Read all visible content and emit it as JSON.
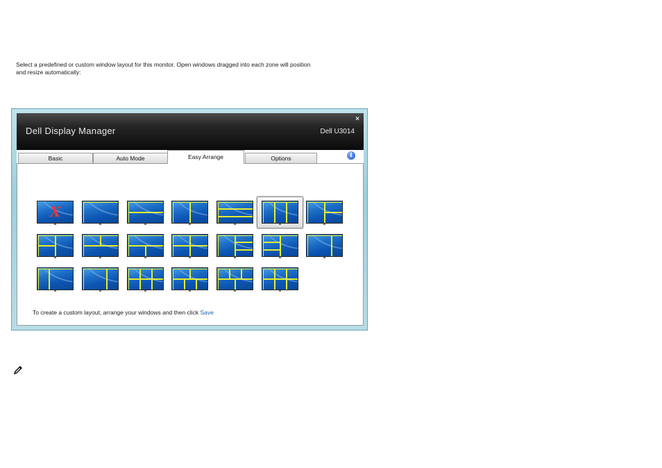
{
  "window": {
    "title": "Dell Display Manager",
    "monitor": "Dell U3014",
    "close_glyph": "×"
  },
  "tabs": [
    {
      "label": "Basic",
      "active": false
    },
    {
      "label": "Auto Mode",
      "active": false
    },
    {
      "label": "Easy Arrange",
      "active": true
    },
    {
      "label": "Options",
      "active": false
    }
  ],
  "info_icon": "info-icon",
  "description": "Select a predefined or custom window layout for this monitor. Open windows dragged into each zone will position and resize automatically:",
  "layouts": {
    "selected_index": 5,
    "none_glyph": "X",
    "count": 20
  },
  "footer": {
    "text": "To create a custom layout, arrange your windows and then click ",
    "link": "Save"
  },
  "colors": {
    "zone_outline": "#e4ef2a",
    "screen_blue": "#1f70c8",
    "link": "#1d5fb0",
    "no_layout_x": "#e23a3a"
  }
}
